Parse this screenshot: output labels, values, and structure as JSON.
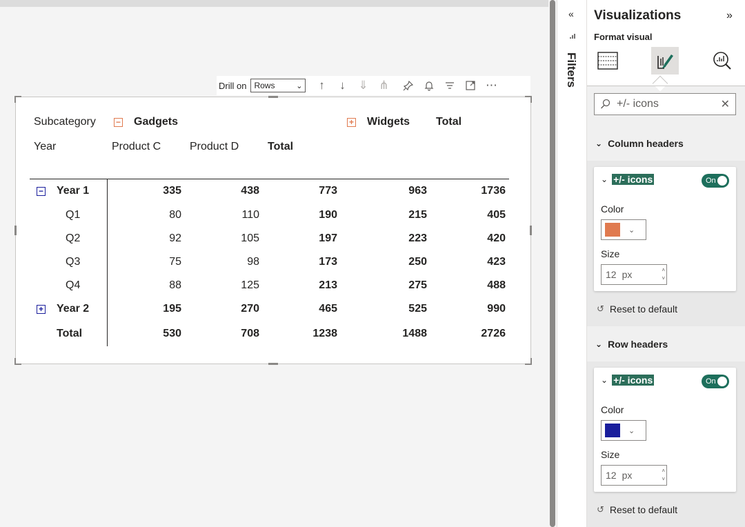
{
  "toolbar": {
    "drill_label": "Drill on",
    "drill_value": "Rows",
    "icons": [
      "arrow-up-icon",
      "arrow-down-icon",
      "double-arrow-down-icon",
      "expand-hierarchy-icon",
      "pin-icon",
      "bell-icon",
      "filter-icon",
      "focus-mode-icon",
      "more-options-icon"
    ]
  },
  "matrix": {
    "subcategory_label": "Subcategory",
    "year_label": "Year",
    "col_groups": [
      {
        "name": "Gadgets",
        "expanded": true
      },
      {
        "name": "Widgets",
        "expanded": false
      }
    ],
    "total_label": "Total",
    "sub_cols": [
      "Product C",
      "Product D",
      "Total"
    ],
    "rows": [
      {
        "label": "Year 1",
        "level": 0,
        "icon": "minus",
        "values": [
          "335",
          "438",
          "773",
          "963",
          "1736"
        ]
      },
      {
        "label": "Q1",
        "level": 1,
        "values": [
          "80",
          "110",
          "190",
          "215",
          "405"
        ]
      },
      {
        "label": "Q2",
        "level": 1,
        "values": [
          "92",
          "105",
          "197",
          "223",
          "420"
        ]
      },
      {
        "label": "Q3",
        "level": 1,
        "values": [
          "75",
          "98",
          "173",
          "250",
          "423"
        ]
      },
      {
        "label": "Q4",
        "level": 1,
        "values": [
          "88",
          "125",
          "213",
          "275",
          "488"
        ]
      },
      {
        "label": "Year 2",
        "level": 0,
        "icon": "plus",
        "values": [
          "195",
          "270",
          "465",
          "525",
          "990"
        ]
      },
      {
        "label": "Total",
        "level": 0,
        "total": true,
        "values": [
          "530",
          "708",
          "1238",
          "1488",
          "2726"
        ]
      }
    ],
    "colors": {
      "column_icon": "#e07a4f",
      "row_icon": "#1a1e9c"
    }
  },
  "filters": {
    "label": "Filters"
  },
  "viz": {
    "title": "Visualizations",
    "format_label": "Format visual",
    "search_value": "+/- icons",
    "column_headers": {
      "label": "Column headers",
      "card_title": "+/- icons",
      "toggle": "On",
      "color_label": "Color",
      "color_value": "#e07a4f",
      "size_label": "Size",
      "size_value": "12",
      "size_unit": "px",
      "reset_label": "Reset to default"
    },
    "row_headers": {
      "label": "Row headers",
      "card_title": "+/- icons",
      "toggle": "On",
      "color_label": "Color",
      "color_value": "#1a1e9c",
      "size_label": "Size",
      "size_value": "12",
      "size_unit": "px",
      "reset_label": "Reset to default"
    }
  }
}
